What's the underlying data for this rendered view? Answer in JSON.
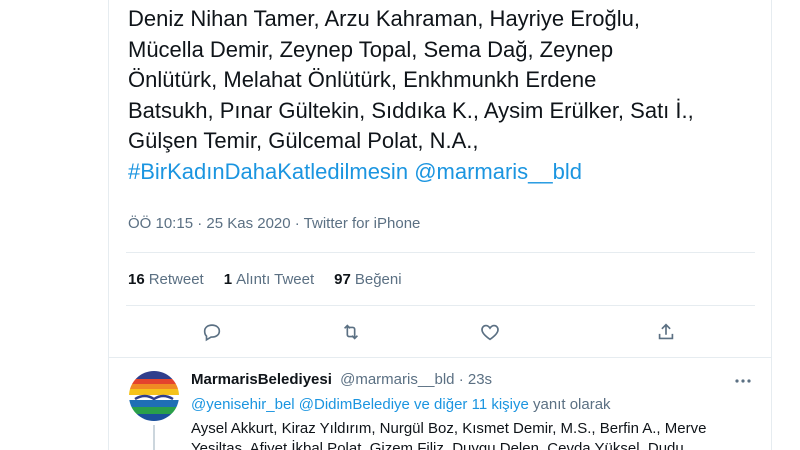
{
  "tweet": {
    "text_lines": [
      "Deniz Nihan Tamer, Arzu Kahraman, Hayriye Eroğlu,",
      "Mücella Demir, Zeynep Topal, Sema Dağ, Zeynep",
      "Önlütürk, Melahat Önlütürk, Enkhmunkh Erdene",
      "Batsukh, Pınar Gültekin, Sıddıka K., Aysim Erülker, Satı İ.,",
      "Gülşen Temir, Gülcemal Polat, N.A.,"
    ],
    "hashtag": "#BirKadınDahaKatledilmesin",
    "mention": "@marmaris__bld",
    "meta": "ÖÖ 10:15 · 25 Kas 2020 · Twitter for iPhone"
  },
  "stats": {
    "retweets_count": "16",
    "retweets_label": "Retweet",
    "quotes_count": "1",
    "quotes_label": "Alıntı Tweet",
    "likes_count": "97",
    "likes_label": "Beğeni"
  },
  "actions": {
    "reply_icon": "reply-icon",
    "retweet_icon": "retweet-icon",
    "like_icon": "heart-icon",
    "share_icon": "share-icon"
  },
  "reply": {
    "name": "MarmarisBelediyesi",
    "handle": "@marmaris__bld · 23s",
    "replying_to_prefix": "@yenisehir_bel @DidimBelediye  ve diğer 11 kişiye",
    "replying_to_suffix": "yanıt olarak",
    "text_lines": [
      "Aysel Akkurt, Kiraz Yıldırım, Nurgül Boz, Kısmet Demir, M.S., Berfin A., Merve",
      "Yeşiltaş, Afiyet İkbal Polat, Gizem Filiz, Duygu Delen, Cevda Yüksel, Dudu"
    ]
  },
  "colors": {
    "link": "#1b95e0",
    "muted": "#5b7083",
    "text": "#0f1419"
  }
}
